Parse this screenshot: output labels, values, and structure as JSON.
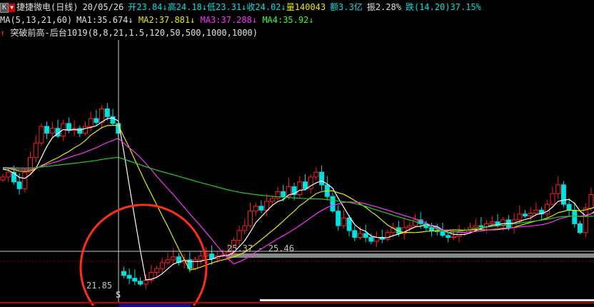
{
  "header": {
    "period_button": "K",
    "stock_name": "捷捷微电(日线)",
    "date": "20/05/26",
    "open_label": "开",
    "open": "23.84",
    "high_label": "高",
    "high": "24.18",
    "low_label": "低",
    "low": "23.31",
    "close_label": "收",
    "close": "24.02",
    "volume_label": "量",
    "volume": "140043",
    "amount_label": "额",
    "amount": "3.3亿",
    "amplitude_label": "振",
    "amplitude": "2.28%",
    "change_label": "跌",
    "change": "(14.20)37.15%",
    "down_arrow": "↓"
  },
  "ma_row": {
    "params": "MA(5,13,21,60)",
    "ma1": "MA1:35.674",
    "ma2": "MA2:37.881",
    "ma3": "MA3:37.288",
    "ma4": "MA4:35.92",
    "arrow": "↓"
  },
  "indicator_row": {
    "arrow": "↑",
    "text": "突破前高-后台1019(8,8,21,1.5,120,50,500,1000,1000)"
  },
  "annotations": {
    "min_price": "21.85",
    "crosshair_price": "25.37 - 25.46",
    "signal": "S"
  },
  "colors": {
    "up": "#ff2020",
    "down": "#00e0e0",
    "ma1": "#ffffff",
    "ma2": "#e8e800",
    "ma3": "#ff33ff",
    "ma4": "#22cc22",
    "circle": "#ff3010"
  },
  "chart_data": {
    "type": "candlestick",
    "price_axis_reference": {
      "price_a": 25.37,
      "price_b": 21.85
    },
    "closes": [
      33.0,
      33.5,
      32.5,
      31.8,
      33.5,
      35,
      36.5,
      38.2,
      37.5,
      38,
      37.2,
      38.5,
      37.8,
      38,
      37.5,
      38.2,
      39,
      38.6,
      40,
      39.2,
      38.5,
      37.5,
      22.9,
      22.6,
      22.3,
      22.0,
      22.4,
      23.2,
      23.6,
      24.2,
      24.5,
      24.8,
      24.2,
      24.5,
      23.6,
      24.5,
      24.9,
      25.1,
      24.6,
      24.9,
      25.0,
      25.3,
      26.5,
      27.5,
      28,
      29.5,
      30,
      29.6,
      30.5,
      30.8,
      31.5,
      31.0,
      32,
      31.2,
      32.5,
      31.8,
      33.0,
      33.5,
      32.2,
      31,
      29.5,
      28,
      28.8,
      27.5,
      26.8,
      27.2,
      26.8,
      26.4,
      26.8,
      26.6,
      27.3,
      27.8,
      27.2,
      27.8,
      28,
      28.6,
      28.2,
      27.8,
      27.5,
      27.4,
      27.0,
      26.8,
      26.9,
      27.3,
      27.5,
      27.8,
      28.0,
      27.9,
      28.2,
      28.4,
      28.0,
      28.6,
      27.8,
      28.6,
      29.2,
      29.0,
      29.3,
      29.6,
      29.2,
      30.2,
      31.3,
      32.2,
      30.2,
      29.6,
      28.2,
      27.3,
      29.8,
      31.2,
      31.6
    ],
    "ma_periods": [
      5,
      13,
      21,
      60
    ]
  }
}
